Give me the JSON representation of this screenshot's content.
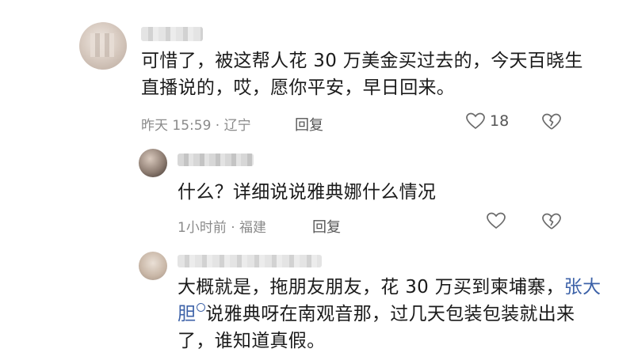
{
  "comment": {
    "text": "可惜了，被这帮人花 30 万美金买过去的，今天百晓生直播说的，哎，愿你平安，早日回来。",
    "meta": "昨天 15:59 · 辽宁",
    "reply_label": "回复",
    "like_count": "18"
  },
  "replies": [
    {
      "text": "什么？详细说说雅典娜什么情况",
      "meta": "1小时前 · 福建",
      "reply_label": "回复"
    },
    {
      "text_before": "大概就是，拖朋友朋友，花 30 万买到柬埔寨，",
      "mention": "张大胆",
      "text_after": "说雅典呀在南观音那，过几天包装包装就出来了，谁知道真假。"
    }
  ],
  "icons": {
    "like": "heart-outline-icon",
    "dislike": "broken-heart-icon",
    "mention": "search-link-icon"
  },
  "colors": {
    "mention": "#3d62a8",
    "meta": "#8a8a8a"
  }
}
